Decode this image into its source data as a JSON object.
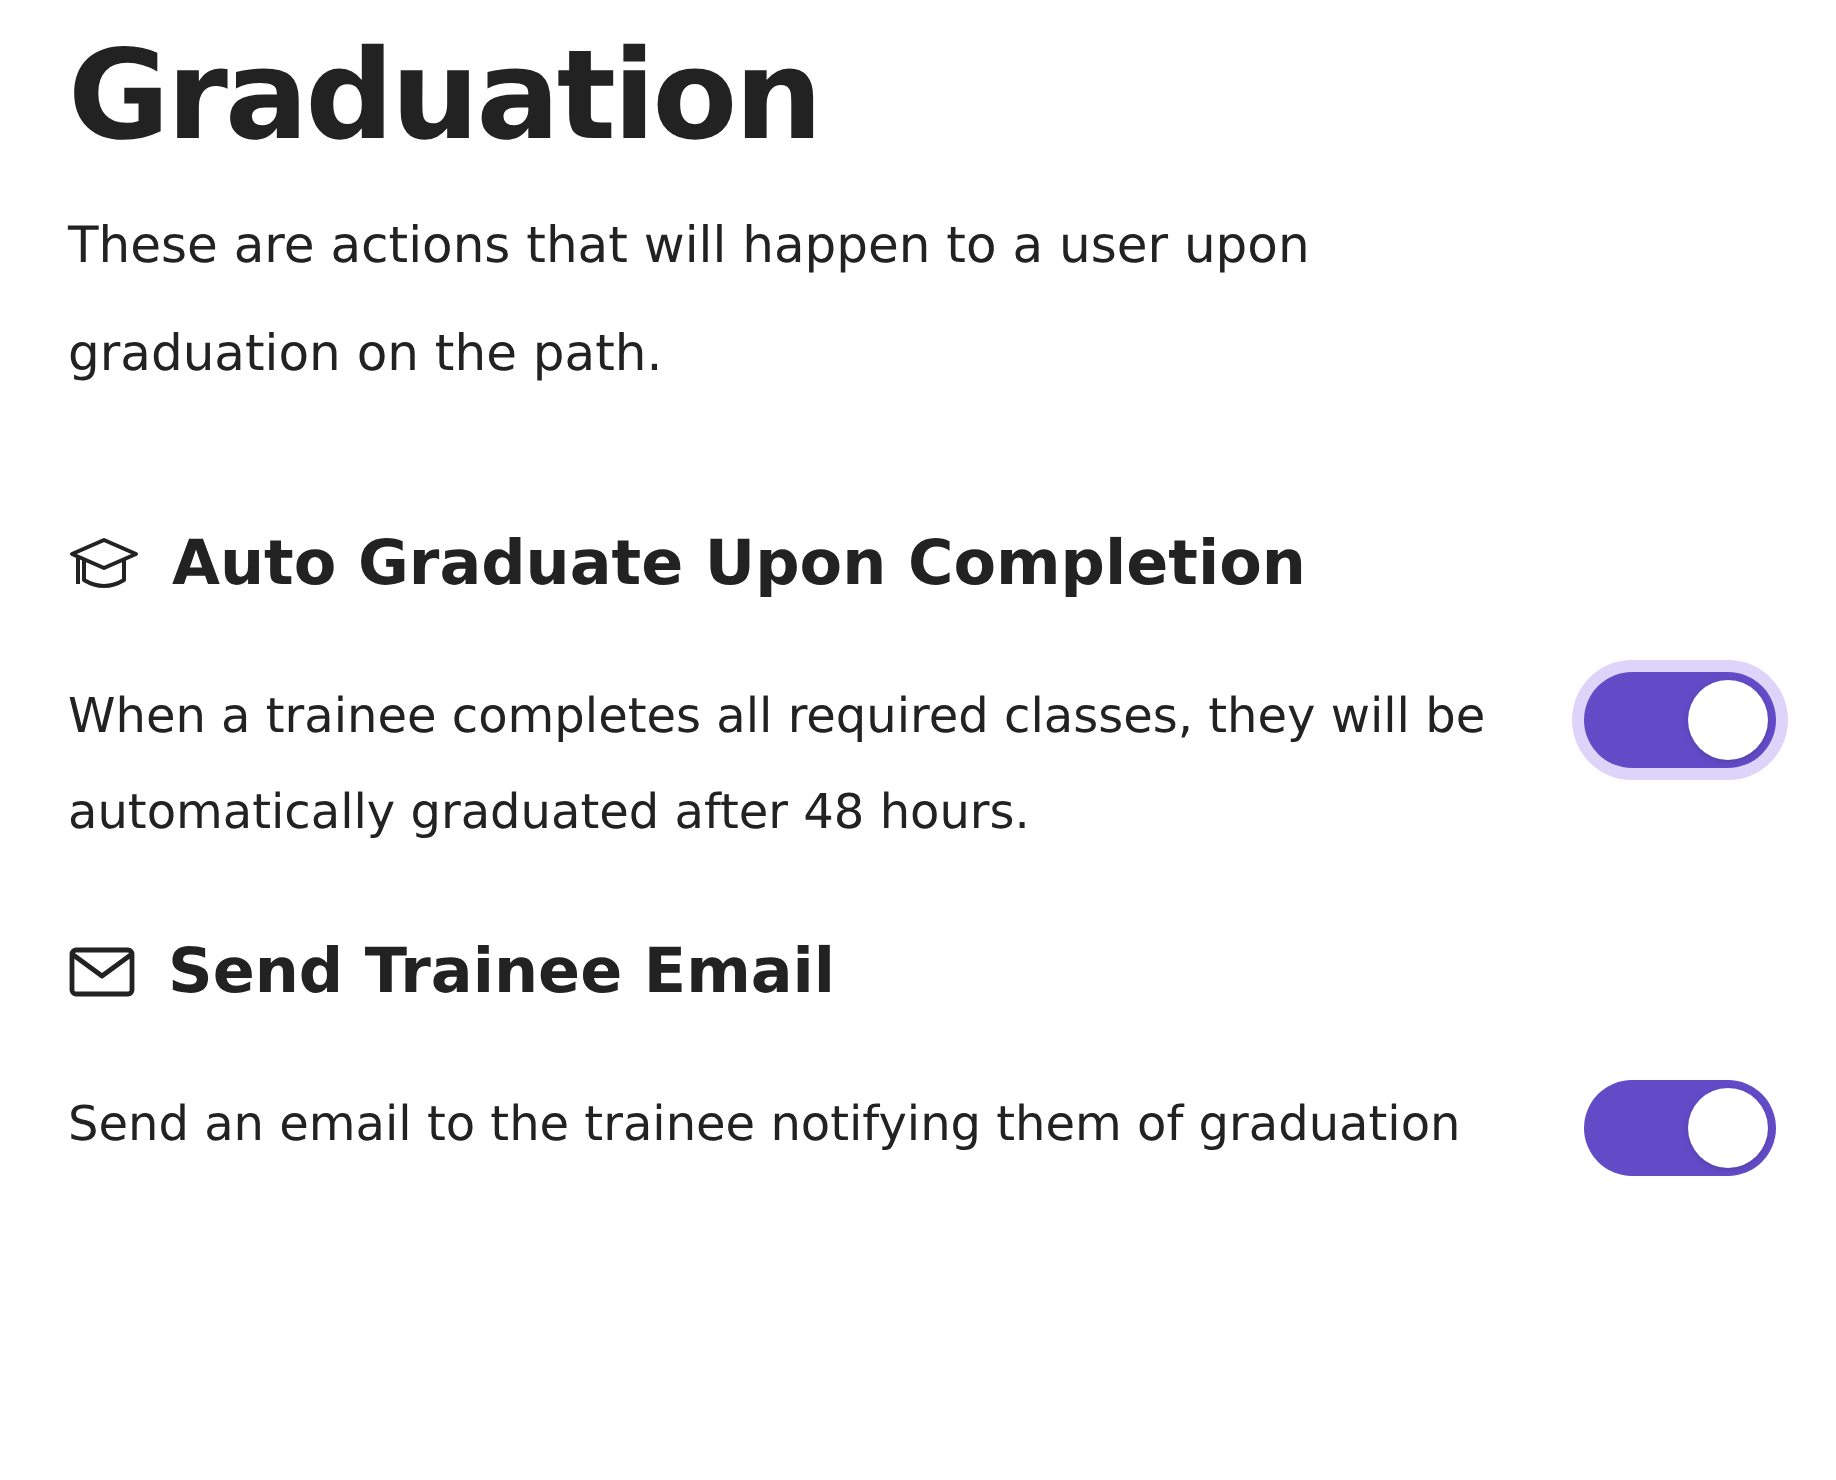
{
  "title": "Graduation",
  "description": "These are actions that will happen to a user upon graduation on the path.",
  "settings": [
    {
      "kind": "cap",
      "label": "Auto Graduate Upon Completion",
      "description": "When a trainee completes all required classes, they will be automatically graduated after 48 hours.",
      "on": true,
      "focused": true
    },
    {
      "kind": "mail",
      "label": "Send Trainee Email",
      "description": "Send an email to the trainee notifying them of graduation",
      "on": true,
      "focused": false
    }
  ]
}
